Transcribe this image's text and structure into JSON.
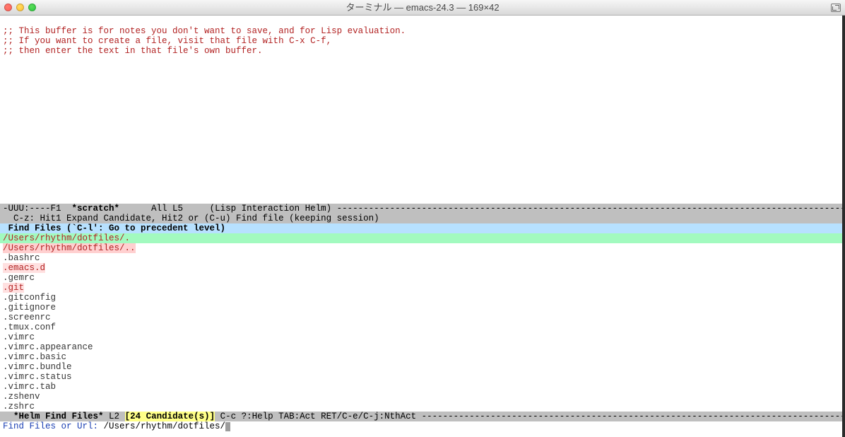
{
  "window": {
    "title": "ターミナル — emacs-24.3 — 169×42"
  },
  "scratch": {
    "line1": ";; This buffer is for notes you don't want to save, and for Lisp evaluation.",
    "line2": ";; If you want to create a file, visit that file with C-x C-f,",
    "line3": ";; then enter the text in that file's own buffer."
  },
  "modeline": {
    "left": "-UUU:----F1  ",
    "buffer": "*scratch*",
    "mid": "      All L5     (Lisp Interaction Helm) ",
    "dashes": "---------------------------------------------------------------------------------------------------------------------------"
  },
  "hint": "  C-z: Hit1 Expand Candidate, Hit2 or (C-u) Find file (keeping session)",
  "helm_header": " Find Files (`C-l': Go to precedent level)",
  "candidates": [
    {
      "text": "/Users/rhythm/dotfiles/.",
      "kind": "current"
    },
    {
      "text": "/Users/rhythm/dotfiles/..",
      "kind": "parent"
    },
    {
      "text": ".bashrc",
      "kind": "file"
    },
    {
      "text": ".emacs.d",
      "kind": "dir"
    },
    {
      "text": ".gemrc",
      "kind": "file"
    },
    {
      "text": ".git",
      "kind": "dir"
    },
    {
      "text": ".gitconfig",
      "kind": "file"
    },
    {
      "text": ".gitignore",
      "kind": "file"
    },
    {
      "text": ".screenrc",
      "kind": "file"
    },
    {
      "text": ".tmux.conf",
      "kind": "file"
    },
    {
      "text": ".vimrc",
      "kind": "file"
    },
    {
      "text": ".vimrc.appearance",
      "kind": "file"
    },
    {
      "text": ".vimrc.basic",
      "kind": "file"
    },
    {
      "text": ".vimrc.bundle",
      "kind": "file"
    },
    {
      "text": ".vimrc.status",
      "kind": "file"
    },
    {
      "text": ".vimrc.tab",
      "kind": "file"
    },
    {
      "text": ".zshenv",
      "kind": "file"
    },
    {
      "text": ".zshrc",
      "kind": "file"
    }
  ],
  "helm_modeline": {
    "pre": "  ",
    "buffer": "*Helm Find Files*",
    "pos": " L2 ",
    "badge": "[24 Candidate(s)]",
    "help": " C-c ?:Help TAB:Act RET/C-e/C-j:NthAct ",
    "dashes": "------------------------------------------------------------------------------------------"
  },
  "minibuffer": {
    "prompt": "Find Files or Url: ",
    "value": "/Users/rhythm/dotfiles/"
  }
}
